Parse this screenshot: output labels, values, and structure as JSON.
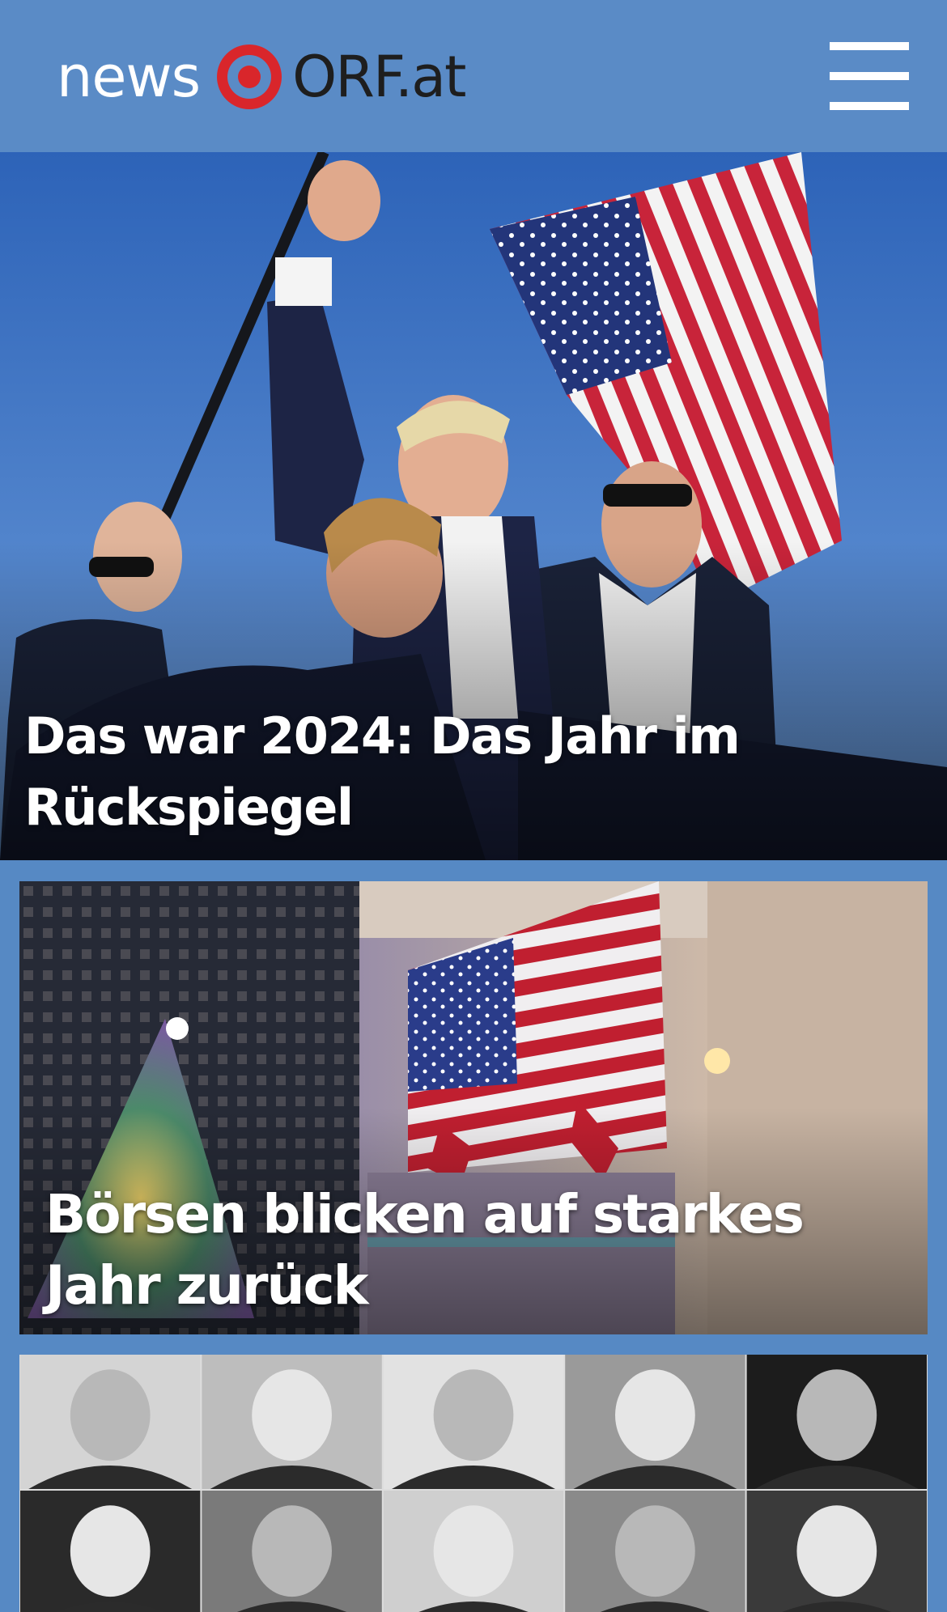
{
  "header": {
    "logo_news": "news",
    "logo_orf": "ORF.at",
    "logo_accent": "#d9262b",
    "menu_icon": "hamburger-menu-icon"
  },
  "stories": [
    {
      "title": "Das war 2024: Das Jahr im Rückspiegel"
    },
    {
      "title": "Börsen blicken auf starkes Jahr zurück"
    }
  ],
  "colors": {
    "brand_blue": "#5a8bc6",
    "page_blue": "#5689c4",
    "title_text": "#ffffff"
  }
}
